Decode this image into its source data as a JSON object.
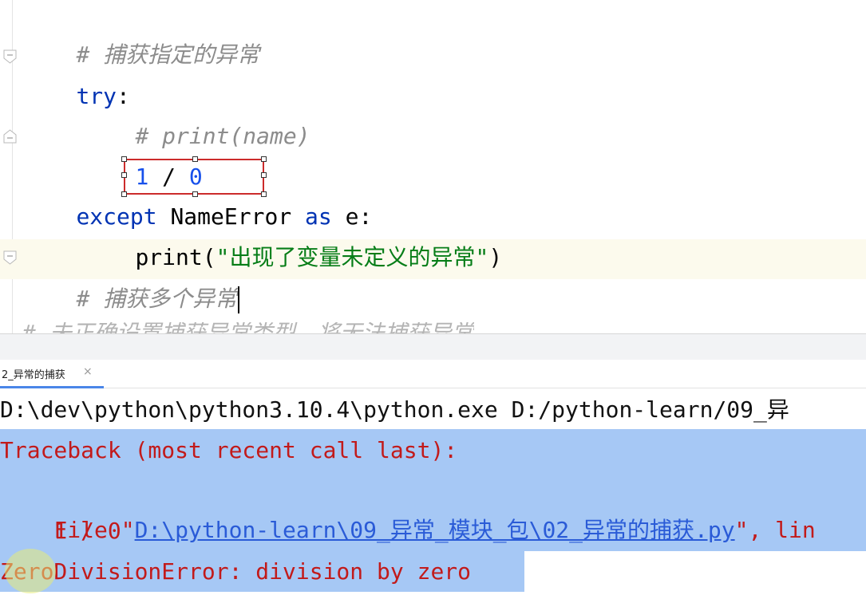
{
  "editor": {
    "lines": {
      "comment_catch_specific": "# 捕获指定的异常",
      "try_kw": "try",
      "colon": ":",
      "comment_print_name": "# print(name)",
      "div_num1": "1",
      "div_op": " / ",
      "div_num2": "0",
      "except_kw": "except ",
      "exception_name": "NameError",
      "as_kw": " as ",
      "var_e": "e:",
      "print_fn": "print(",
      "print_str": "\"出现了变量未定义的异常\"",
      "print_close": ")",
      "comment_catch_multiple": "# 捕获多个异常",
      "comment_cut": "# 未正确设置捕获异常类型，将无法捕获异常"
    }
  },
  "run_panel": {
    "tab_label": "2_异常的捕获",
    "tab_close": "×",
    "output": {
      "command": "D:\\dev\\python\\python3.10.4\\python.exe D:/python-learn/09_异",
      "traceback": "Traceback (most recent call last):",
      "file_prefix": "  File \"",
      "file_path": "D:\\python-learn\\09_异常_模块_包\\02_异常的捕获.py",
      "file_suffix": "\", lin",
      "code_line": "    1 / 0",
      "error": "ZeroDivisionError: division by zero"
    }
  },
  "colors": {
    "keyword": "#0033b3",
    "number": "#1750eb",
    "comment": "#8c8c8c",
    "string": "#067d17",
    "error_text": "#c21a1a",
    "selection": "#a6c8f5",
    "highlight_box": "#cc2b2b"
  }
}
